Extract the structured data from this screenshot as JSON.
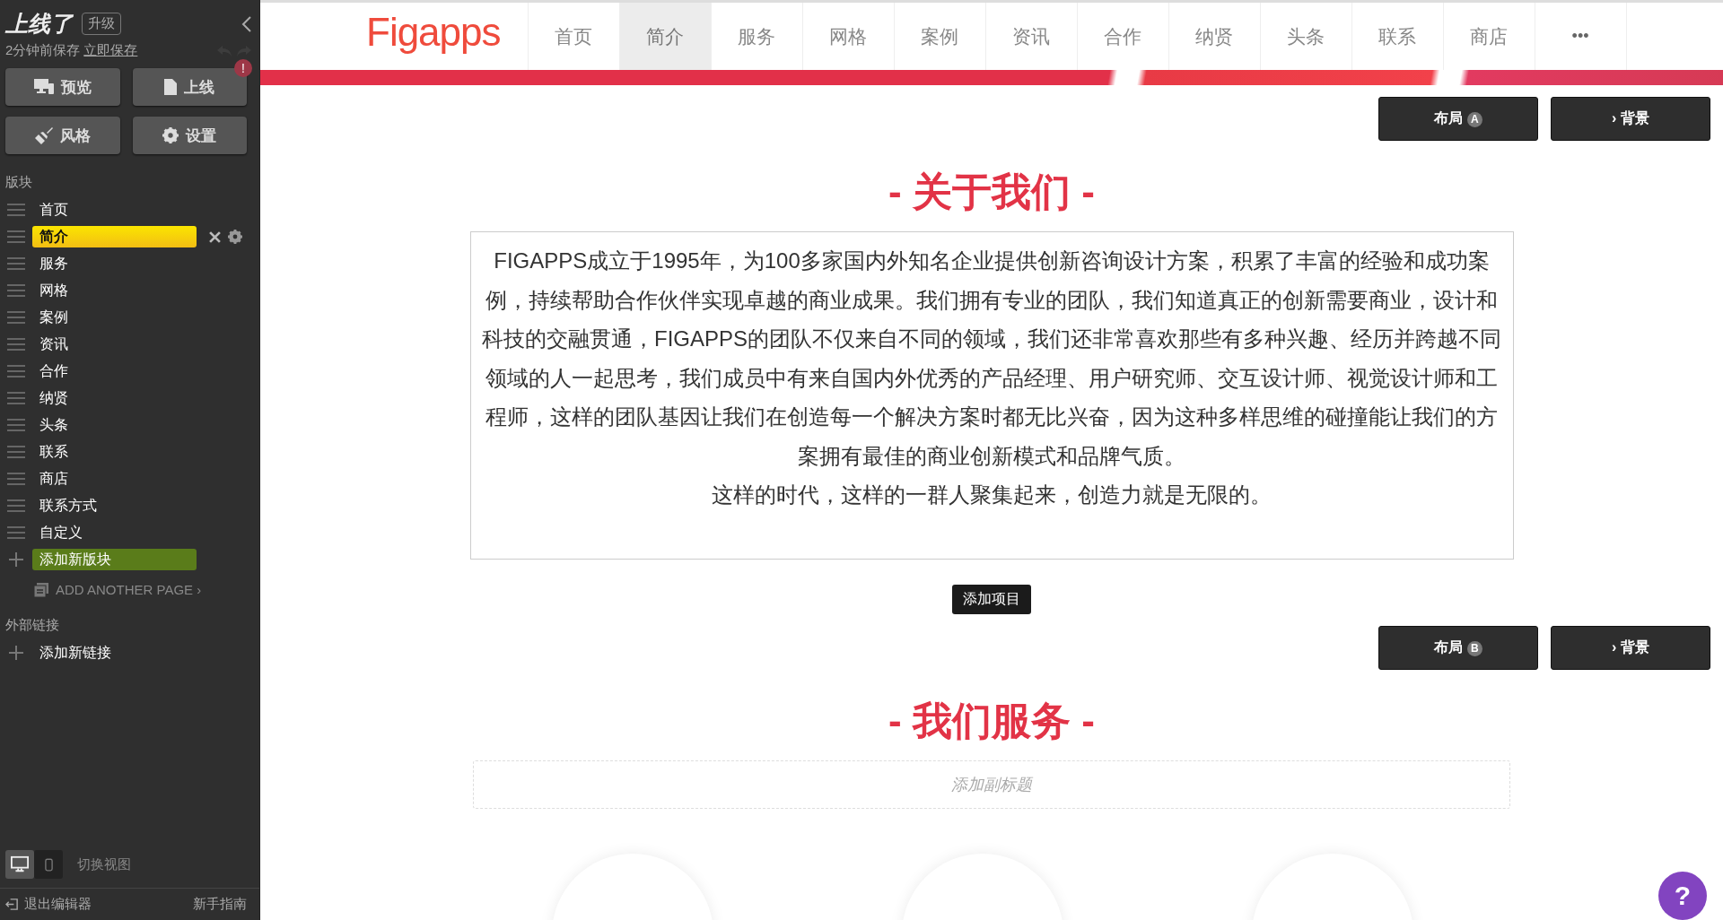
{
  "editor": {
    "site_status": "上线了",
    "upgrade": "升级",
    "save_status": "2分钟前保存",
    "save_now": "立即保存",
    "actions": [
      {
        "label": "预览",
        "kind": "monitor",
        "alert": false
      },
      {
        "label": "上线",
        "kind": "document",
        "alert": true
      },
      {
        "label": "风格",
        "kind": "brush",
        "alert": false
      },
      {
        "label": "设置",
        "kind": "gear",
        "alert": false
      }
    ],
    "alert_mark": "!",
    "sections_label": "版块",
    "sections": [
      {
        "label": "首页",
        "selected": false
      },
      {
        "label": "简介",
        "selected": true
      },
      {
        "label": "服务",
        "selected": false
      },
      {
        "label": "网格",
        "selected": false
      },
      {
        "label": "案例",
        "selected": false
      },
      {
        "label": "资讯",
        "selected": false
      },
      {
        "label": "合作",
        "selected": false
      },
      {
        "label": "纳贤",
        "selected": false
      },
      {
        "label": "头条",
        "selected": false
      },
      {
        "label": "联系",
        "selected": false
      },
      {
        "label": "商店",
        "selected": false
      },
      {
        "label": "联系方式",
        "selected": false
      },
      {
        "label": "自定义",
        "selected": false
      }
    ],
    "add_section": "添加新版块",
    "add_page": "ADD ANOTHER PAGE",
    "add_page_chevron": "›",
    "links_label": "外部链接",
    "add_link": "添加新链接",
    "views": [
      {
        "kind": "desktop",
        "selected": true
      },
      {
        "kind": "mobile",
        "selected": false
      }
    ],
    "view_label": "切换视图",
    "exit": "退出编辑器",
    "guide": "新手指南"
  },
  "site": {
    "logo": "Figapps",
    "nav": [
      {
        "label": "首页",
        "selected": false
      },
      {
        "label": "简介",
        "selected": true
      },
      {
        "label": "服务",
        "selected": false
      },
      {
        "label": "网格",
        "selected": false
      },
      {
        "label": "案例",
        "selected": false
      },
      {
        "label": "资讯",
        "selected": false
      },
      {
        "label": "合作",
        "selected": false
      },
      {
        "label": "纳贤",
        "selected": false
      },
      {
        "label": "头条",
        "selected": false
      },
      {
        "label": "联系",
        "selected": false
      },
      {
        "label": "商店",
        "selected": false
      }
    ],
    "nav_more": "•••",
    "sections": [
      {
        "layout_label": "布局",
        "layout_badge": "A",
        "background": "背景",
        "chevron": "›",
        "title": "- 关于我们 -",
        "body": [
          "FIGAPPS成立于1995年，为100多家国内外知名企业提供创新咨询设计方案，积累了丰富的经验和成功案例，持续帮助合作伙伴实现卓越的商业成果。我们拥有专业的团队，我们知道真正的创新需要商业，设计和科技的交融贯通，FIGAPPS的团队不仅来自不同的领域，我们还非常喜欢那些有多种兴趣、经历并跨越不同领域的人一起思考，我们成员中有来自国内外优秀的产品经理、用户研究师、交互设计师、视觉设计师和工程师，这样的团队基因让我们在创造每一个解决方案时都无比兴奋，因为这种多样思维的碰撞能让我们的方案拥有最佳的商业创新模式和品牌气质。",
          "这样的时代，这样的一群人聚集起来，创造力就是无限的。"
        ],
        "add_item": "添加项目"
      },
      {
        "layout_label": "布局",
        "layout_badge": "B",
        "background": "背景",
        "chevron": "›",
        "title": "- 我们服务 -",
        "subtitle_placeholder": "添加副标题"
      }
    ],
    "help": "?"
  }
}
